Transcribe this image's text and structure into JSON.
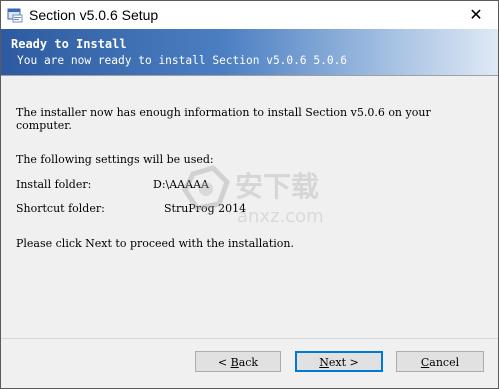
{
  "window": {
    "title": "Section v5.0.6 Setup",
    "close_glyph": "✕"
  },
  "header": {
    "title": "Ready to Install",
    "subtitle": "You are now ready to install Section v5.0.6 5.0.6"
  },
  "content": {
    "intro_line1": "The installer now has enough information to install Section v5.0.6 on your",
    "intro_line2": "computer.",
    "settings_heading": "The following settings will be used:",
    "install_folder_label": "Install folder:",
    "install_folder_value": "D:\\AAAAA",
    "shortcut_folder_label": "Shortcut folder:",
    "shortcut_folder_value": "StruProg 2014",
    "next_instruction": "Please click Next to proceed with the installation."
  },
  "watermark": {
    "text_cn": "安下载",
    "text_en": "anxz.com"
  },
  "buttons": {
    "back_prefix": "< ",
    "back_hotkey": "B",
    "back_rest": "ack",
    "next_hotkey": "N",
    "next_rest": "ext >",
    "cancel_hotkey": "C",
    "cancel_rest": "ancel"
  },
  "icons": {
    "app_icon": "setup-app-icon"
  }
}
